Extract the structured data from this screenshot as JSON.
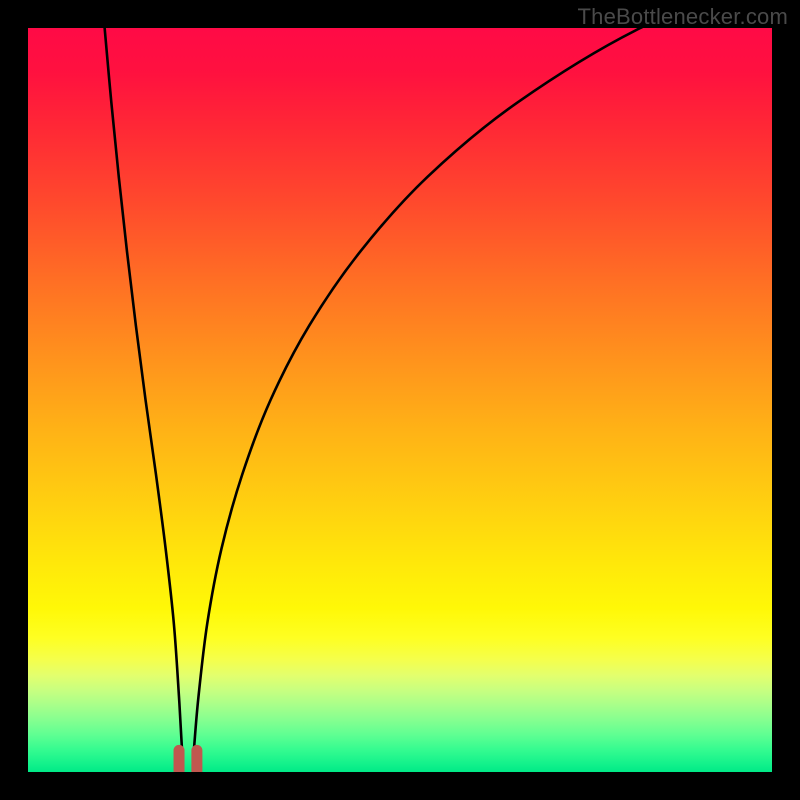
{
  "watermark": {
    "text": "TheBottlenecker.com"
  },
  "colors": {
    "frame": "#000000",
    "curve": "#000000",
    "marker": "#c0584f",
    "gradient_top": "#ff0a46",
    "gradient_bottom": "#00ea87"
  },
  "chart_data": {
    "type": "line",
    "title": "",
    "xlabel": "",
    "ylabel": "",
    "xlim": [
      0,
      100
    ],
    "ylim": [
      0,
      100
    ],
    "grid": false,
    "series": [
      {
        "name": "left-branch",
        "x": [
          10.3,
          11.2,
          12.2,
          13.3,
          14.5,
          15.8,
          17.2,
          18.5,
          19.6,
          20.3,
          20.7
        ],
        "y": [
          100,
          90,
          80,
          70,
          60,
          50,
          40,
          30,
          20,
          10,
          3
        ]
      },
      {
        "name": "right-branch",
        "x": [
          22.3,
          22.9,
          24.1,
          26.0,
          28.8,
          32.6,
          37.8,
          44.7,
          53.7,
          65.8,
          82.3,
          100
        ],
        "y": [
          3,
          10,
          20,
          30,
          40,
          50,
          60,
          70,
          80,
          90,
          100,
          107
        ]
      }
    ],
    "marker": {
      "name": "optimal-point",
      "x": 21.5,
      "y": 1.3,
      "width": 2.4
    },
    "note": "Axis values are relative percentages read from figure geometry; no tick labels are shown."
  }
}
